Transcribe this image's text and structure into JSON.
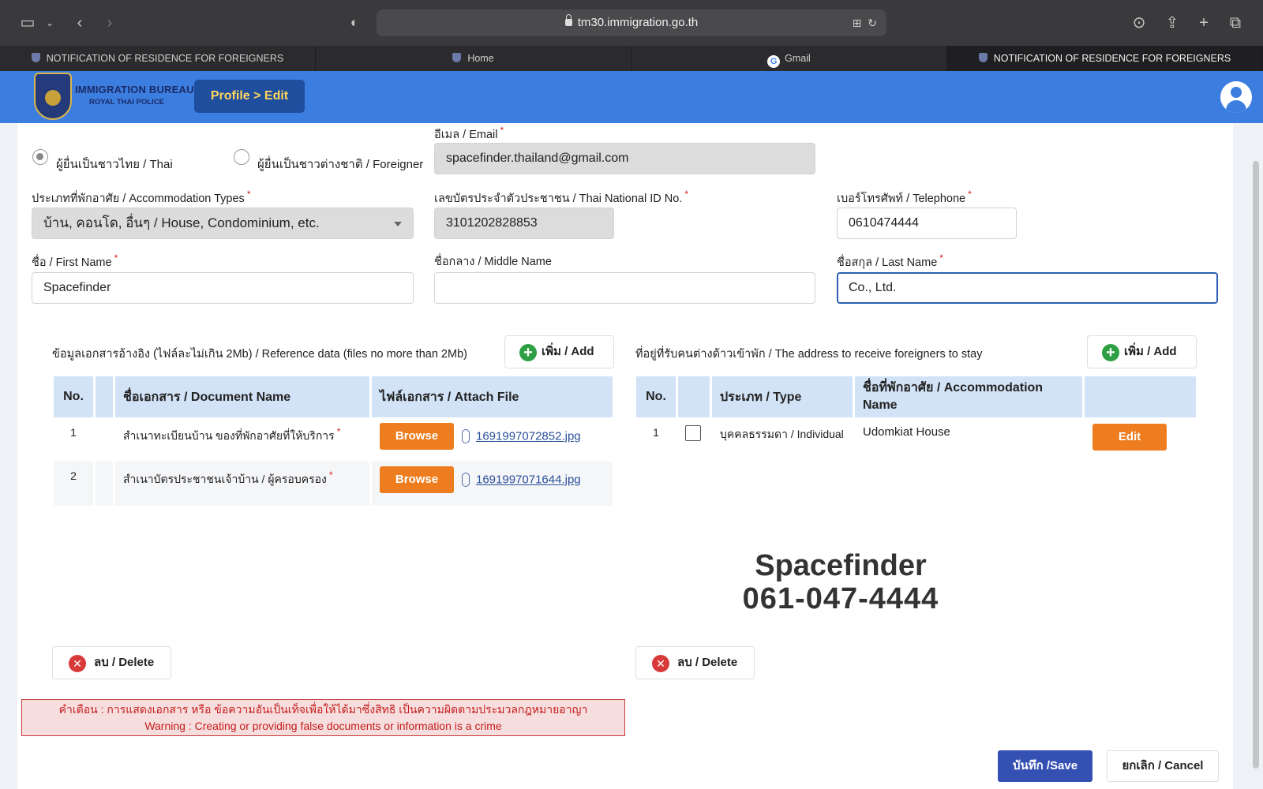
{
  "browser": {
    "url": "tm30.immigration.go.th",
    "tabs": [
      {
        "label": "NOTIFICATION OF RESIDENCE FOR FOREIGNERS",
        "active": false
      },
      {
        "label": "Home",
        "active": false
      },
      {
        "label": "Gmail",
        "active": false
      },
      {
        "label": "NOTIFICATION OF RESIDENCE FOR FOREIGNERS",
        "active": true
      }
    ]
  },
  "header": {
    "logo_line1": "IMMIGRATION BUREAU",
    "logo_line2": "ROYAL THAI POLICE",
    "breadcrumb": "Profile > Edit"
  },
  "form": {
    "applicant_thai_label": "ผู้ยื่นเป็นชาวไทย / Thai",
    "applicant_foreigner_label": "ผู้ยื่นเป็นชาวต่างชาติ / Foreigner",
    "applicant_selected": "thai",
    "email_label": "อีเมล / Email",
    "email_value": "spacefinder.thailand@gmail.com",
    "accommodation_type_label": "ประเภทที่พักอาศัย / Accommodation Types",
    "accommodation_type_value": "บ้าน, คอนโด, อื่นๆ / House, Condominium, etc.",
    "national_id_label": "เลขบัตรประจำตัวประชาชน / Thai National ID No.",
    "national_id_value": "3101202828853",
    "telephone_label": "เบอร์โทรศัพท์ / Telephone",
    "telephone_value": "0610474444",
    "first_name_label": "ชื่อ / First Name",
    "first_name_value": "Spacefinder",
    "middle_name_label": "ชื่อกลาง / Middle Name",
    "middle_name_value": "",
    "last_name_label": "ชื่อสกุล / Last Name",
    "last_name_value": "Co., Ltd.",
    "required_mark": "*"
  },
  "documents": {
    "title": "ข้อมูลเอกสารอ้างอิง (ไฟล์ละไม่เกิน 2Mb) / Reference data (files no more than 2Mb)",
    "add_label": "เพิ่ม / Add",
    "columns": [
      "No.",
      "",
      "ชื่อเอกสาร / Document Name",
      "ไฟล์เอกสาร / Attach File"
    ],
    "browse_label": "Browse",
    "rows": [
      {
        "no": "1",
        "name": "สำเนาทะเบียนบ้าน ของที่พักอาศัยที่ให้บริการ",
        "file": "1691997072852.jpg"
      },
      {
        "no": "2",
        "name": "สำเนาบัตรประชาชนเจ้าบ้าน / ผู้ครอบครอง",
        "file": "1691997071644.jpg"
      }
    ],
    "delete_label": "ลบ / Delete"
  },
  "addresses": {
    "title": "ที่อยู่ที่รับคนต่างด้าวเข้าพัก / The address to receive foreigners to stay",
    "add_label": "เพิ่ม / Add",
    "columns": [
      "No.",
      "",
      "ประเภท / Type",
      "ชื่อที่พักอาศัย / Accommodation Name",
      ""
    ],
    "rows": [
      {
        "no": "1",
        "type": "บุคคลธรรมดา / Individual",
        "name": "Udomkiat House",
        "edit_label": "Edit"
      }
    ],
    "delete_label": "ลบ / Delete"
  },
  "watermark": {
    "line1": "Spacefinder",
    "line2": "061-047-4444"
  },
  "warning": {
    "thai": "คำเตือน : การแสดงเอกสาร หรือ ข้อความอันเป็นเท็จเพื่อให้ได้มาซึ่งสิทธิ เป็นความผิดตามประมวลกฎหมายอาญา",
    "english": "Warning : Creating or providing false documents or information is a crime"
  },
  "actions": {
    "save_label": "บันทึก /Save",
    "cancel_label": "ยกเลิก / Cancel"
  }
}
